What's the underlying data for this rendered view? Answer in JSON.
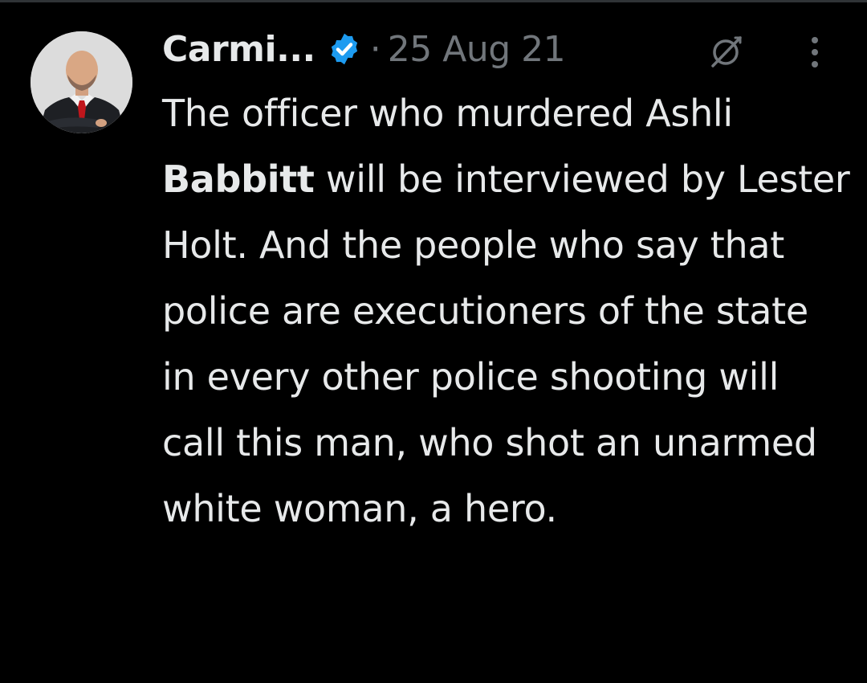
{
  "tweet": {
    "author": {
      "display_name": "Carmi...",
      "verified": true,
      "avatar_icon": "profile-photo"
    },
    "separator": "·",
    "timestamp": "25 Aug 21",
    "icons": {
      "grok": "slashed-circle-icon",
      "more": "vertical-ellipsis-icon"
    },
    "text": {
      "p1": "The officer who murdered Ashli ",
      "highlight": "Babbitt",
      "p2": " will be interviewed by Lester Holt. And the people who say that police are executioners of the state in every other police shooting will call this man, who shot an unarmed white woman, a hero."
    }
  },
  "colors": {
    "background": "#000000",
    "text": "#e7e9ea",
    "muted": "#71767b",
    "verified": "#1d9bf0"
  }
}
